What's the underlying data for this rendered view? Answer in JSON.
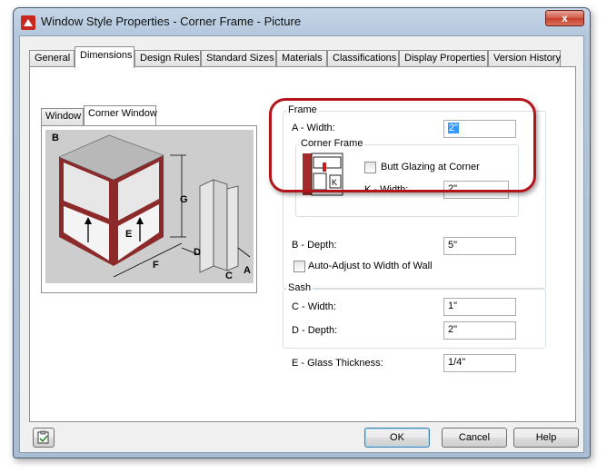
{
  "window": {
    "title": "Window Style Properties - Corner Frame - Picture",
    "close_label": "x"
  },
  "tabs": [
    {
      "label": "General"
    },
    {
      "label": "Dimensions"
    },
    {
      "label": "Design Rules"
    },
    {
      "label": "Standard Sizes"
    },
    {
      "label": "Materials"
    },
    {
      "label": "Classifications"
    },
    {
      "label": "Display Properties"
    },
    {
      "label": "Version History"
    }
  ],
  "preview": {
    "tabs": [
      {
        "label": "Window"
      },
      {
        "label": "Corner Window"
      }
    ],
    "dimension_labels": [
      "B",
      "G",
      "E",
      "F",
      "D",
      "C",
      "A"
    ]
  },
  "frame": {
    "group_label": "Frame",
    "a_width_label": "A - Width:",
    "a_width_value": "2\"",
    "corner_frame": {
      "group_label": "Corner Frame",
      "butt_glazing_label": "Butt Glazing at Corner",
      "butt_glazing_checked": false,
      "k_width_label": "K - Width:",
      "k_width_value": "2\"",
      "diagram_label": "K"
    },
    "b_depth_label": "B - Depth:",
    "b_depth_value": "5\"",
    "auto_adjust_label": "Auto-Adjust to Width of Wall",
    "auto_adjust_checked": false
  },
  "sash": {
    "group_label": "Sash",
    "c_width_label": "C - Width:",
    "c_width_value": "1\"",
    "d_depth_label": "D - Depth:",
    "d_depth_value": "2\""
  },
  "glass": {
    "label": "E - Glass Thickness:",
    "value": "1/4\""
  },
  "buttons": {
    "ok": "OK",
    "cancel": "Cancel",
    "help": "Help"
  },
  "colors": {
    "accent_red": "#b3141b",
    "frame_red": "#a32b2b"
  }
}
